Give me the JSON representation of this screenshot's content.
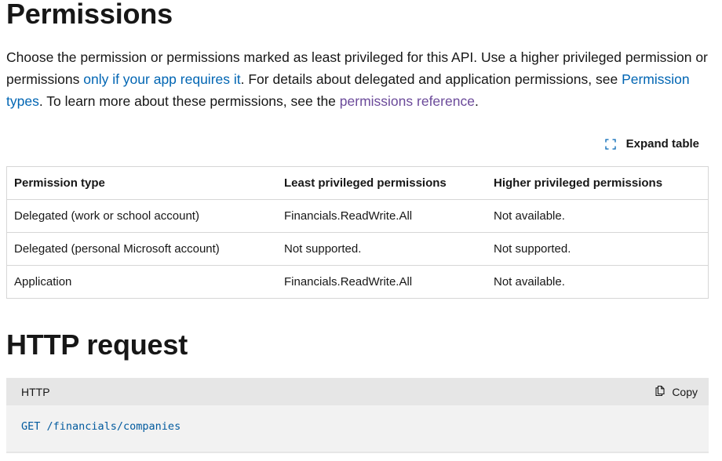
{
  "permissions": {
    "title": "Permissions",
    "intro": {
      "part1": "Choose the permission or permissions marked as least privileged for this API. Use a higher privileged permission or permissions ",
      "link1": "only if your app requires it",
      "part2": ". For details about delegated and application permissions, see ",
      "link2": "Permission types",
      "part3": ". To learn more about these permissions, see the ",
      "link3": "permissions reference",
      "part4": "."
    },
    "expand_label": "Expand table",
    "table": {
      "headers": [
        "Permission type",
        "Least privileged permissions",
        "Higher privileged permissions"
      ],
      "rows": [
        [
          "Delegated (work or school account)",
          "Financials.ReadWrite.All",
          "Not available."
        ],
        [
          "Delegated (personal Microsoft account)",
          "Not supported.",
          "Not supported."
        ],
        [
          "Application",
          "Financials.ReadWrite.All",
          "Not available."
        ]
      ]
    }
  },
  "http_request": {
    "title": "HTTP request",
    "code_language": "HTTP",
    "copy_label": "Copy",
    "code": "GET /financials/companies"
  },
  "colors": {
    "link": "#0065b3",
    "visited_link": "#6b4a9a",
    "code_text": "#005a9e",
    "code_header_bg": "#e6e6e6",
    "code_body_bg": "#f2f2f2"
  }
}
